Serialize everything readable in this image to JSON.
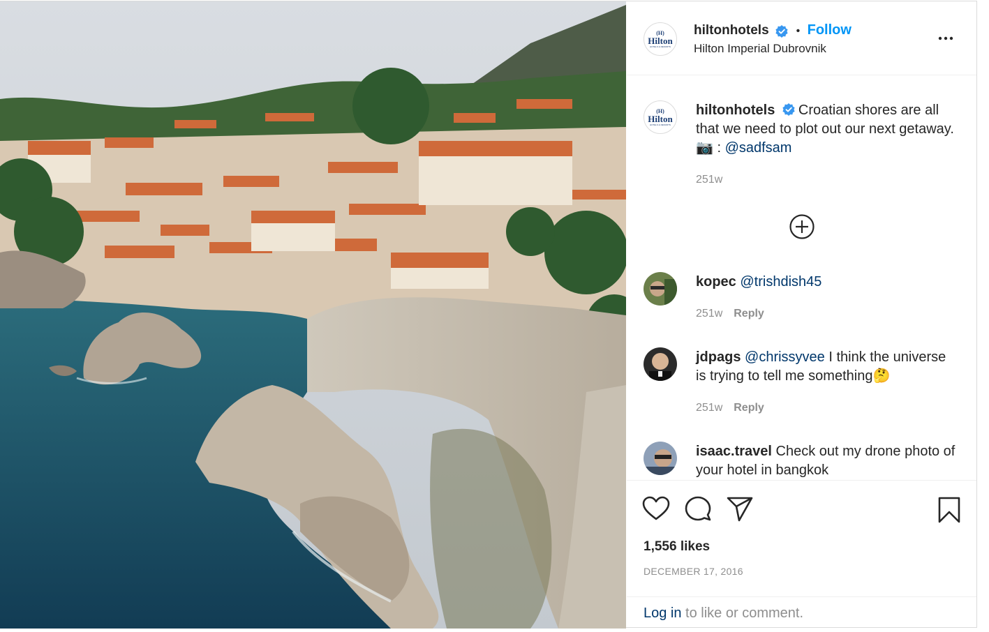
{
  "post": {
    "username": "hiltonhotels",
    "follow_label": "Follow",
    "separator": "•",
    "location": "Hilton Imperial Dubrovnik",
    "avatar_text_top": "(H)",
    "avatar_text": "Hilton",
    "avatar_sub": "HOTELS & RESORTS"
  },
  "caption": {
    "username": "hiltonhotels",
    "text": "Croatian shores are all that we need to plot out our next getaway. 📷 : ",
    "mention": "@sadfsam",
    "age": "251w"
  },
  "comments": [
    {
      "username": "kopec",
      "mention": "@trishdish45",
      "text": "",
      "age": "251w",
      "reply_label": "Reply"
    },
    {
      "username": "jdpags",
      "mention": "@chrissyvee",
      "text": " I think the universe is trying to tell me something🤔",
      "age": "251w",
      "reply_label": "Reply"
    },
    {
      "username": "isaac.travel",
      "mention": "",
      "text": " Check out my drone photo of your hotel in bangkok",
      "age": "",
      "reply_label": ""
    }
  ],
  "stats": {
    "likes": "1,556 likes",
    "date": "DECEMBER 17, 2016"
  },
  "login": {
    "link": "Log in",
    "rest": " to like or comment."
  },
  "icons": {
    "verified": "verified-badge-icon",
    "more": "more-options-icon",
    "load_more": "plus-circle-icon",
    "like": "heart-icon",
    "comment": "comment-icon",
    "share": "paper-plane-icon",
    "save": "bookmark-icon"
  },
  "colors": {
    "link": "#0095f6",
    "mention": "#00376b",
    "muted": "#8e8e8e",
    "verified": "#3897f0"
  }
}
